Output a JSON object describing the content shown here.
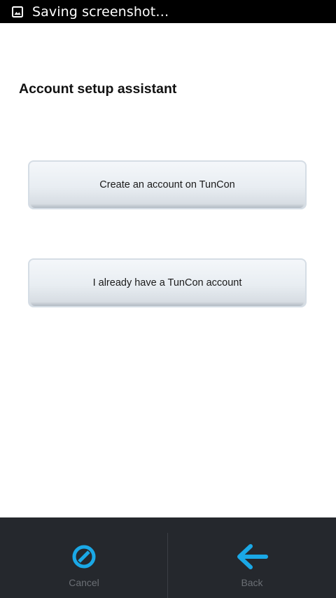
{
  "status_bar": {
    "notification_icon": "image-icon",
    "text": "Saving screenshot…"
  },
  "page": {
    "title": "Account setup assistant"
  },
  "options": {
    "create_account_label": "Create an account on TunCon",
    "existing_account_label": "I already have a TunCon account"
  },
  "bottom_bar": {
    "cancel_label": "Cancel",
    "cancel_icon": "cancel-icon",
    "back_label": "Back",
    "back_icon": "arrow-left-icon",
    "accent_color": "#1aa8e6"
  }
}
